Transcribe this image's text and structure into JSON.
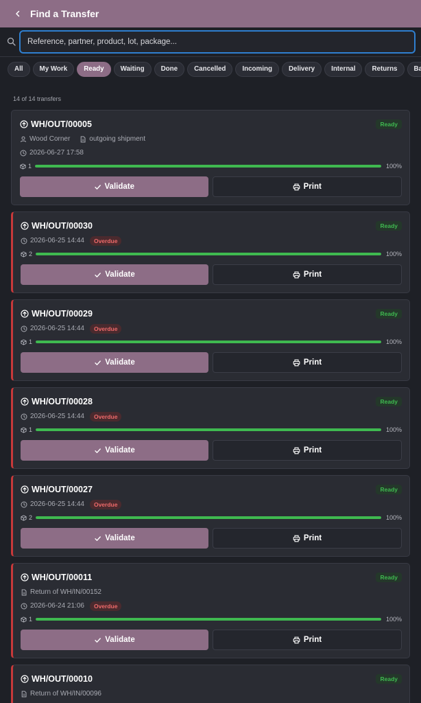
{
  "header": {
    "title": "Find a Transfer"
  },
  "search": {
    "placeholder": "Reference, partner, product, lot, package..."
  },
  "filters": [
    "All",
    "My Work",
    "Ready",
    "Waiting",
    "Done",
    "Cancelled",
    "Incoming",
    "Delivery",
    "Internal",
    "Returns",
    "Backorders"
  ],
  "active_filter": "Ready",
  "count_text": "14 of 14 transfers",
  "labels": {
    "validate": "Validate",
    "print": "Print",
    "overdue": "Overdue"
  },
  "colors": {
    "accent": "#8d6d86",
    "ready": "#3fb950",
    "overdue": "#c8393a",
    "focus": "#2f7fd0"
  },
  "transfers": [
    {
      "ref": "WH/OUT/00005",
      "status": "Ready",
      "partner": "Wood Corner",
      "origin": "outgoing shipment",
      "date": "2026-06-27 17:58",
      "overdue": false,
      "qty": "1",
      "progress": "100%"
    },
    {
      "ref": "WH/OUT/00030",
      "status": "Ready",
      "date": "2026-06-25 14:44",
      "overdue": true,
      "qty": "2",
      "progress": "100%"
    },
    {
      "ref": "WH/OUT/00029",
      "status": "Ready",
      "date": "2026-06-25 14:44",
      "overdue": true,
      "qty": "1",
      "progress": "100%"
    },
    {
      "ref": "WH/OUT/00028",
      "status": "Ready",
      "date": "2026-06-25 14:44",
      "overdue": true,
      "qty": "1",
      "progress": "100%"
    },
    {
      "ref": "WH/OUT/00027",
      "status": "Ready",
      "date": "2026-06-25 14:44",
      "overdue": true,
      "qty": "2",
      "progress": "100%"
    },
    {
      "ref": "WH/OUT/00011",
      "status": "Ready",
      "origin": "Return of WH/IN/00152",
      "date": "2026-06-24 21:06",
      "overdue": true,
      "qty": "1",
      "progress": "100%"
    },
    {
      "ref": "WH/OUT/00010",
      "status": "Ready",
      "origin": "Return of WH/IN/00096",
      "overdue": true
    }
  ]
}
